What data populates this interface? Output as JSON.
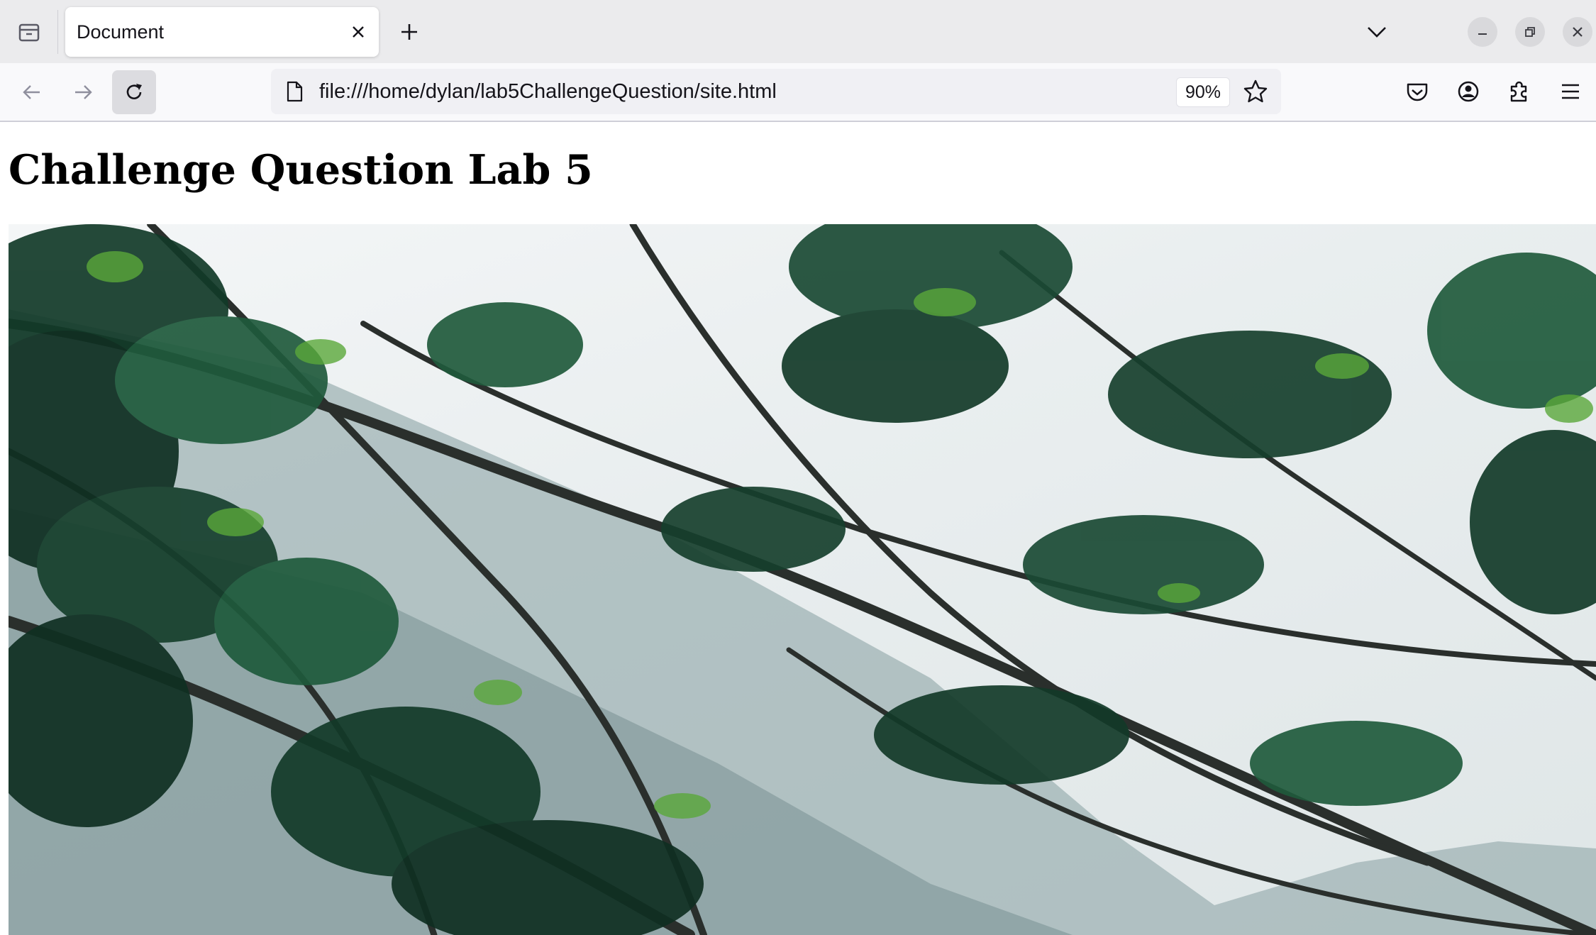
{
  "browser": {
    "tab": {
      "title": "Document"
    },
    "url": "file:///home/dylan/lab5ChallengeQuestion/site.html",
    "zoom": "90%"
  },
  "icons": {
    "tab_manager": "tab-manager-icon",
    "tab_close": "close-icon",
    "new_tab": "plus-icon",
    "tab_list": "chevron-down-icon",
    "minimize": "minimize-icon",
    "maximize": "restore-icon",
    "close_window": "close-icon",
    "back": "arrow-left-icon",
    "forward": "arrow-right-icon",
    "reload": "reload-icon",
    "page": "page-icon",
    "bookmark": "star-icon",
    "pocket": "pocket-icon",
    "account": "account-icon",
    "extensions": "puzzle-icon",
    "menu": "hamburger-menu-icon"
  },
  "page": {
    "heading": "Challenge Question Lab 5",
    "image_subject": "evergreen tree branches against a pale sky with a mountain slope"
  },
  "colors": {
    "tabstrip_bg": "#ebebed",
    "toolbar_bg": "#f9f9fb",
    "urlbar_bg": "#f0f0f4",
    "foliage_dark": "#0f2f22",
    "foliage_mid": "#1f5a3c",
    "foliage_light": "#5aa83a",
    "sky": "#f1f3f4"
  }
}
